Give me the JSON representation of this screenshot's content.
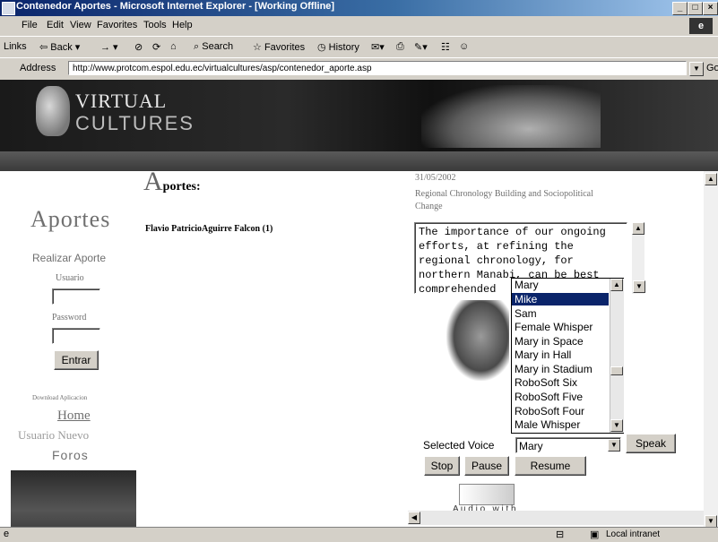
{
  "window": {
    "title": "Contenedor Aportes - Microsoft Internet Explorer - [Working Offline]"
  },
  "menubar": [
    "File",
    "Edit",
    "View",
    "Favorites",
    "Tools",
    "Help"
  ],
  "toolbar": {
    "links": "Links",
    "back": "Back",
    "search": "Search",
    "favorites": "Favorites",
    "history": "History"
  },
  "address": {
    "label": "Address",
    "url": "http://www.protcom.espol.edu.ec/virtualcultures/asp/contenedor_aporte.asp",
    "go": "Go"
  },
  "banner": {
    "line1": "VIRTUAL",
    "line2": "CULTURES"
  },
  "sidebar": {
    "heading": "Aportes",
    "realizar": "Realizar Aporte",
    "usuario_label": "Usuario",
    "password_label": "Password",
    "entrar": "Entrar",
    "download": "Download Aplicacion",
    "home": "Home",
    "usuario_nuevo": "Usuario Nuevo",
    "foros": "Foros"
  },
  "main": {
    "heading_initial": "A",
    "heading_rest": "portes:",
    "author": "Flavio PatricioAguirre Falcon (1)"
  },
  "article": {
    "date": "31/05/2002",
    "title": "Regional Chronology Building and Sociopolitical Change",
    "text_lines": [
      "The importance of our ongoing",
      "efforts, at refining the",
      "regional chronology, for",
      "northern Manabi, can be best",
      "comprehended"
    ]
  },
  "voice": {
    "options": [
      "Mary",
      "Mike",
      "Sam",
      "Female Whisper",
      "Mary in Space",
      "Mary in Hall",
      "Mary in Stadium",
      "RoboSoft Six",
      "RoboSoft Five",
      "RoboSoft Four",
      "Male Whisper"
    ],
    "highlighted": "Mike",
    "top_value": "Mary",
    "selected_label": "Selected Voice",
    "selected_value": "Mary",
    "speak": "Speak",
    "stop": "Stop",
    "pause": "Pause",
    "resume": "Resume",
    "caption": "A u d i o   w i t h"
  },
  "statusbar": {
    "zone": "Local intranet"
  }
}
